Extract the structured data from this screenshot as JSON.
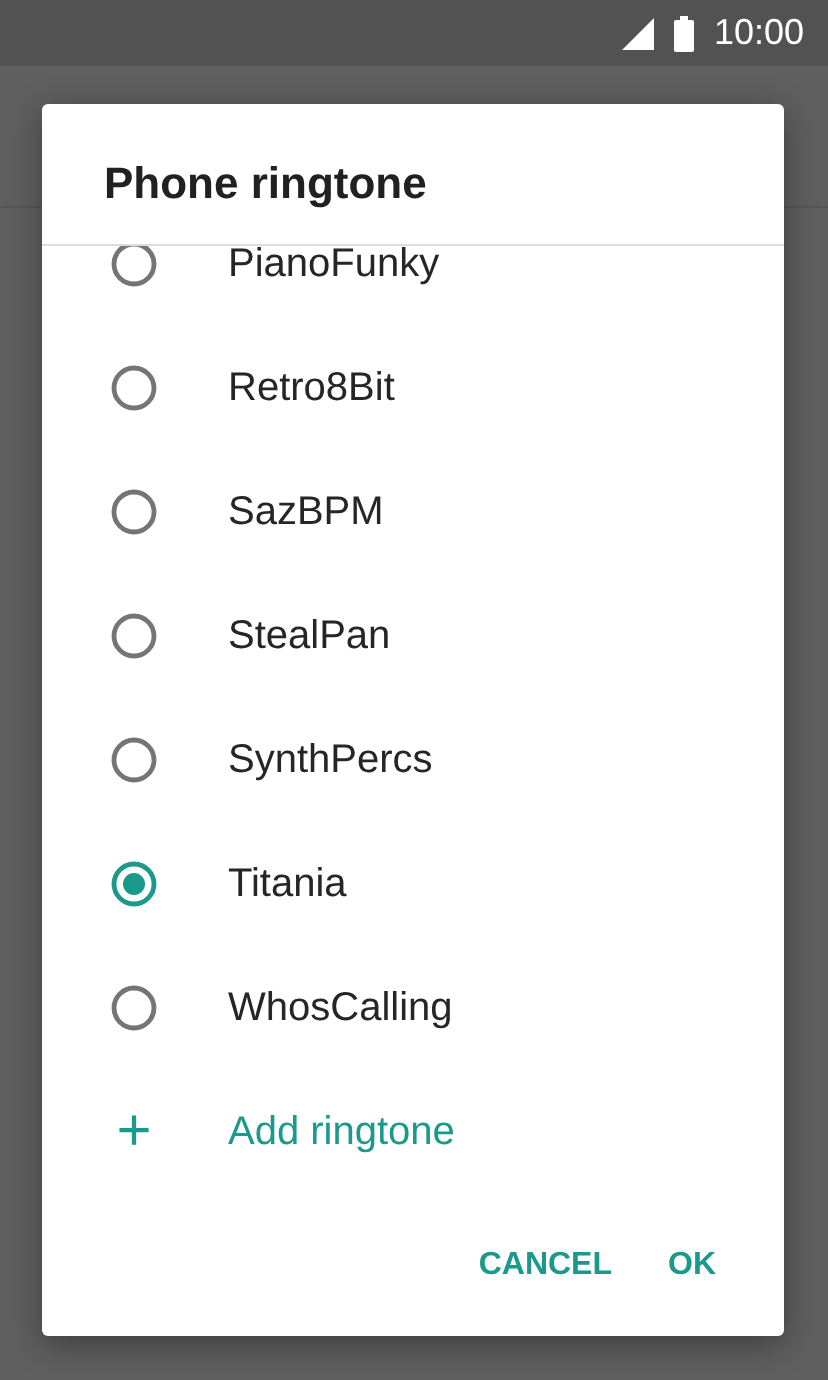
{
  "status_bar": {
    "time": "10:00"
  },
  "dialog": {
    "title": "Phone ringtone",
    "options": [
      {
        "label": "PianoFunky",
        "selected": false
      },
      {
        "label": "Retro8Bit",
        "selected": false
      },
      {
        "label": "SazBPM",
        "selected": false
      },
      {
        "label": "StealPan",
        "selected": false
      },
      {
        "label": "SynthPercs",
        "selected": false
      },
      {
        "label": "Titania",
        "selected": true
      },
      {
        "label": "WhosCalling",
        "selected": false
      }
    ],
    "add_action": {
      "icon": "+",
      "label": "Add ringtone"
    },
    "buttons": [
      "CANCEL",
      "OK"
    ]
  }
}
